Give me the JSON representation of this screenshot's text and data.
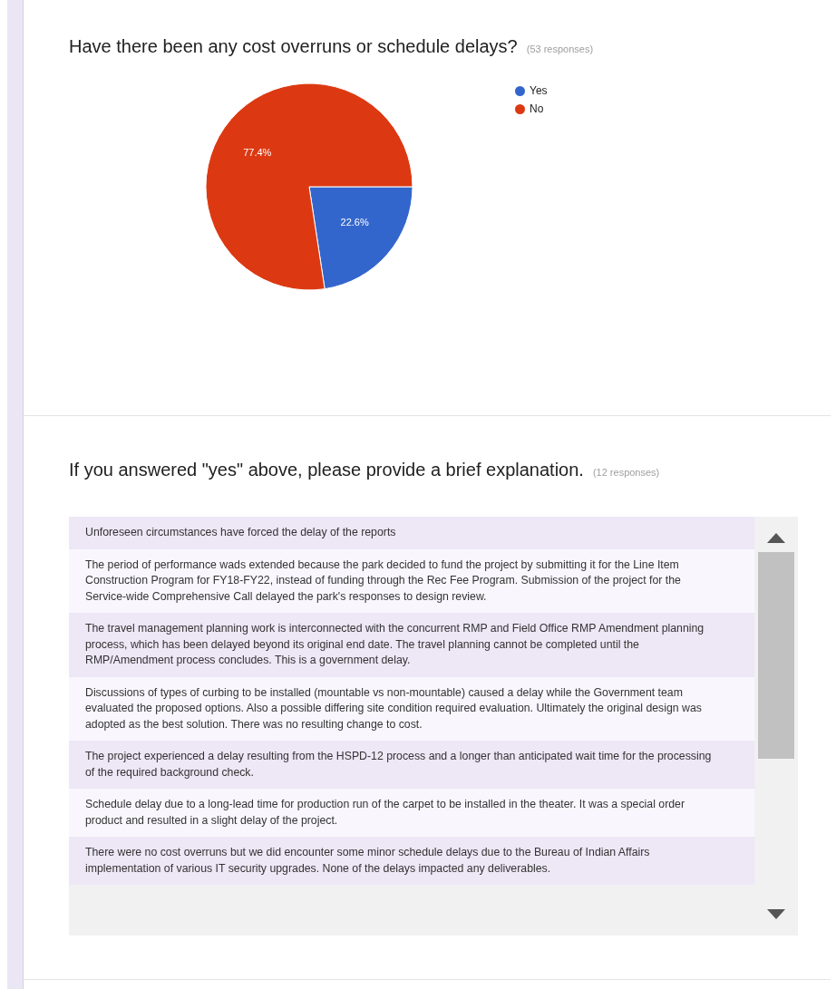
{
  "questions": [
    {
      "kind": "pie",
      "title": "Have there been any cost overruns or schedule delays?",
      "count": "(53 responses)",
      "chart_data": {
        "type": "pie",
        "categories": [
          "Yes",
          "No"
        ],
        "values": [
          22.6,
          77.4
        ],
        "colors": [
          "#3366cc",
          "#dc3912"
        ],
        "value_labels": [
          "22.6%",
          "77.4%"
        ]
      }
    },
    {
      "kind": "list",
      "title": "If you answered \"yes\" above, please provide a brief explanation.",
      "count": "(12 responses)",
      "responses": [
        "Unforeseen circumstances have forced the delay of the reports",
        "The period of performance wads extended because the park decided to fund the project by submitting it for the Line Item Construction Program for FY18-FY22, instead of funding through the Rec Fee Program. Submission of the project for the Service-wide Comprehensive Call delayed the park's responses to design review.",
        "The travel management planning work is interconnected with the concurrent RMP and Field Office RMP Amendment planning process, which has been delayed beyond its original end date. The travel planning cannot be completed until the RMP/Amendment process concludes. This is a government delay.",
        "Discussions of types of curbing to be installed (mountable vs non-mountable) caused a delay while the Government team evaluated the proposed options. Also a possible differing site condition required evaluation. Ultimately the original design was adopted as the best solution. There was no resulting change to cost.",
        "The project experienced a delay resulting from the HSPD-12 process and a longer than anticipated wait time for the processing of the required background check.",
        "Schedule delay due to a long-lead time for production run of the carpet to be installed in the theater. It was a special order product and resulted in a slight delay of the project.",
        "There were no cost overruns but we did encounter some minor schedule delays due to the Bureau of Indian Affairs implementation of various IT security upgrades. None of the delays impacted any deliverables."
      ]
    }
  ]
}
